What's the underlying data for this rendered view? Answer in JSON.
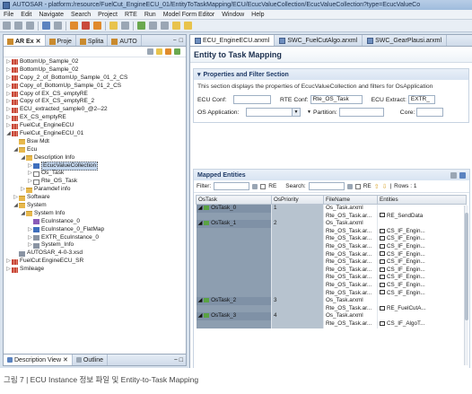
{
  "window": {
    "title": "AUTOSAR - platform:/resource/FuelCut_EngineECU_01/EntityToTaskMapping/ECU/EcucValueCollection/EcucValueCollection?type=EcucValueCo"
  },
  "menu": [
    "File",
    "Edit",
    "Navigate",
    "Search",
    "Project",
    "RTE",
    "Run",
    "Model Form Editor",
    "Window",
    "Help"
  ],
  "left_tabs": [
    "AR Ex",
    "Proje",
    "Splita",
    "AUTO"
  ],
  "tree": [
    {
      "indent": 0,
      "exp": "▷",
      "icon": "i-as",
      "label": "BottomUp_Sample_02"
    },
    {
      "indent": 0,
      "exp": "▷",
      "icon": "i-as",
      "label": "BottomUp_Sample_02"
    },
    {
      "indent": 0,
      "exp": "▷",
      "icon": "i-as",
      "label": "Copy_2_of_BottomUp_Sample_01_2_CS"
    },
    {
      "indent": 0,
      "exp": "▷",
      "icon": "i-as",
      "label": "Copy_of_BottomUp_Sample_01_2_CS"
    },
    {
      "indent": 0,
      "exp": "▷",
      "icon": "i-as",
      "label": "Copy of EX_CS_emptyRE"
    },
    {
      "indent": 0,
      "exp": "▷",
      "icon": "i-as",
      "label": "Copy of EX_CS_emptyRE_2"
    },
    {
      "indent": 0,
      "exp": "▷",
      "icon": "i-as",
      "label": "ECU_extracted_sample0_@2--22"
    },
    {
      "indent": 0,
      "exp": "▷",
      "icon": "i-as",
      "label": "EX_CS_emptyRE"
    },
    {
      "indent": 0,
      "exp": "▷",
      "icon": "i-as",
      "label": "FuelCut_EngineECU"
    },
    {
      "indent": 0,
      "exp": "◢",
      "icon": "i-as",
      "label": "FuelCut_EngineECU_01"
    },
    {
      "indent": 1,
      "exp": "",
      "icon": "i-folder",
      "label": "Bsw Mdt"
    },
    {
      "indent": 1,
      "exp": "◢",
      "icon": "i-folder",
      "label": "Ecu"
    },
    {
      "indent": 2,
      "exp": "◢",
      "icon": "i-folder",
      "label": "Description Info"
    },
    {
      "indent": 3,
      "exp": "▷",
      "icon": "i-blue",
      "label": "EcucValueCollection",
      "selected": true
    },
    {
      "indent": 3,
      "exp": "▷",
      "icon": "i-box",
      "label": "Os_Task"
    },
    {
      "indent": 3,
      "exp": "▷",
      "icon": "i-box",
      "label": "Rte_OS_Task"
    },
    {
      "indent": 2,
      "exp": "▷",
      "icon": "i-folder",
      "label": "Paramdef info"
    },
    {
      "indent": 1,
      "exp": "▷",
      "icon": "i-folder",
      "label": "Software"
    },
    {
      "indent": 1,
      "exp": "◢",
      "icon": "i-folder",
      "label": "System"
    },
    {
      "indent": 2,
      "exp": "◢",
      "icon": "i-folder",
      "label": "System Info"
    },
    {
      "indent": 3,
      "exp": "",
      "icon": "i-purple",
      "label": "EcuInstance_0"
    },
    {
      "indent": 3,
      "exp": "▷",
      "icon": "i-blue",
      "label": "EcuInstance_0_FlatMap"
    },
    {
      "indent": 3,
      "exp": "▷",
      "icon": "i-gray",
      "label": "EXTR_EcuInstance_0"
    },
    {
      "indent": 3,
      "exp": "▷",
      "icon": "i-gray",
      "label": "System_Info"
    },
    {
      "indent": 1,
      "exp": "",
      "icon": "i-gray",
      "label": "AUTOSAR_4-0-3.xsd"
    },
    {
      "indent": 0,
      "exp": "▷",
      "icon": "i-as",
      "label": "FuelCut:EngineECU_SR"
    },
    {
      "indent": 0,
      "exp": "▷",
      "icon": "i-as",
      "label": "Smileage"
    }
  ],
  "outline_tabs": [
    "Description View",
    "Outline"
  ],
  "editor_tabs": [
    "ECU_EngineECU.arxml",
    "SWC_FuelCutAlgo.arxml",
    "SWC_GearPlausi.arxml"
  ],
  "editor": {
    "title": "Entity to Task Mapping",
    "section_title": "Properties and Filter Section",
    "section_desc": "This section displays the properties of EcucValueCollection and filters for OsApplication",
    "fields": {
      "ecu_conf_label": "ECU Conf:",
      "rte_conf_label": "RTE Conf:",
      "rte_conf_value": "Rte_OS_Task",
      "ecu_extract_label": "ECU Extract:",
      "ecu_extract_value": "EXTR_",
      "os_app_label": "OS Application:",
      "partition_label": "Partition:",
      "core_label": "Core:"
    }
  },
  "mapped": {
    "title": "Mapped Entities",
    "filter_label": "Filter:",
    "re_label": "RE",
    "search_label": "Search:",
    "rows_label": "Rows : 1",
    "columns": [
      "OsTask",
      "OsPriority",
      "FileName",
      "Entities"
    ],
    "rows": [
      {
        "group": true,
        "task": "OsTask_0",
        "prio": "1",
        "file": "Os_Task.arxml",
        "entity": ""
      },
      {
        "group": false,
        "task": "",
        "prio": "",
        "file": "Rte_OS_Task.ar...",
        "entity": "RE_SendData"
      },
      {
        "group": true,
        "task": "OsTask_1",
        "prio": "2",
        "file": "Os_Task.arxml",
        "entity": ""
      },
      {
        "group": false,
        "task": "",
        "prio": "",
        "file": "Rte_OS_Task.ar...",
        "entity": "CS_IF_Engin..."
      },
      {
        "group": false,
        "task": "",
        "prio": "",
        "file": "Rte_OS_Task.ar...",
        "entity": "CS_IF_Engin..."
      },
      {
        "group": false,
        "task": "",
        "prio": "",
        "file": "Rte_OS_Task.ar...",
        "entity": "CS_IF_Engin..."
      },
      {
        "group": false,
        "task": "",
        "prio": "",
        "file": "Rte_OS_Task.ar...",
        "entity": "CS_IF_Engin..."
      },
      {
        "group": false,
        "task": "",
        "prio": "",
        "file": "Rte_OS_Task.ar...",
        "entity": "CS_IF_Engin..."
      },
      {
        "group": false,
        "task": "",
        "prio": "",
        "file": "Rte_OS_Task.ar...",
        "entity": "CS_IF_Engin..."
      },
      {
        "group": false,
        "task": "",
        "prio": "",
        "file": "Rte_OS_Task.ar...",
        "entity": "CS_IF_Engin..."
      },
      {
        "group": false,
        "task": "",
        "prio": "",
        "file": "Rte_OS_Task.ar...",
        "entity": "CS_IF_Engin..."
      },
      {
        "group": false,
        "task": "",
        "prio": "",
        "file": "Rte_OS_Task.ar...",
        "entity": "CS_IF_Engin..."
      },
      {
        "group": true,
        "task": "OsTask_2",
        "prio": "3",
        "file": "Os_Task.arxml",
        "entity": ""
      },
      {
        "group": false,
        "task": "",
        "prio": "",
        "file": "Rte_OS_Task.ar...",
        "entity": "RE_FuelCutA..."
      },
      {
        "group": true,
        "task": "OsTask_3",
        "prio": "4",
        "file": "Os_Task.arxml",
        "entity": ""
      },
      {
        "group": false,
        "task": "",
        "prio": "",
        "file": "Rte_OS_Task.ar...",
        "entity": "CS_IF_AlgoT..."
      }
    ]
  },
  "caption": "그림 7 | ECU Instance 정보 파일 및 Entity-to-Task Mapping"
}
